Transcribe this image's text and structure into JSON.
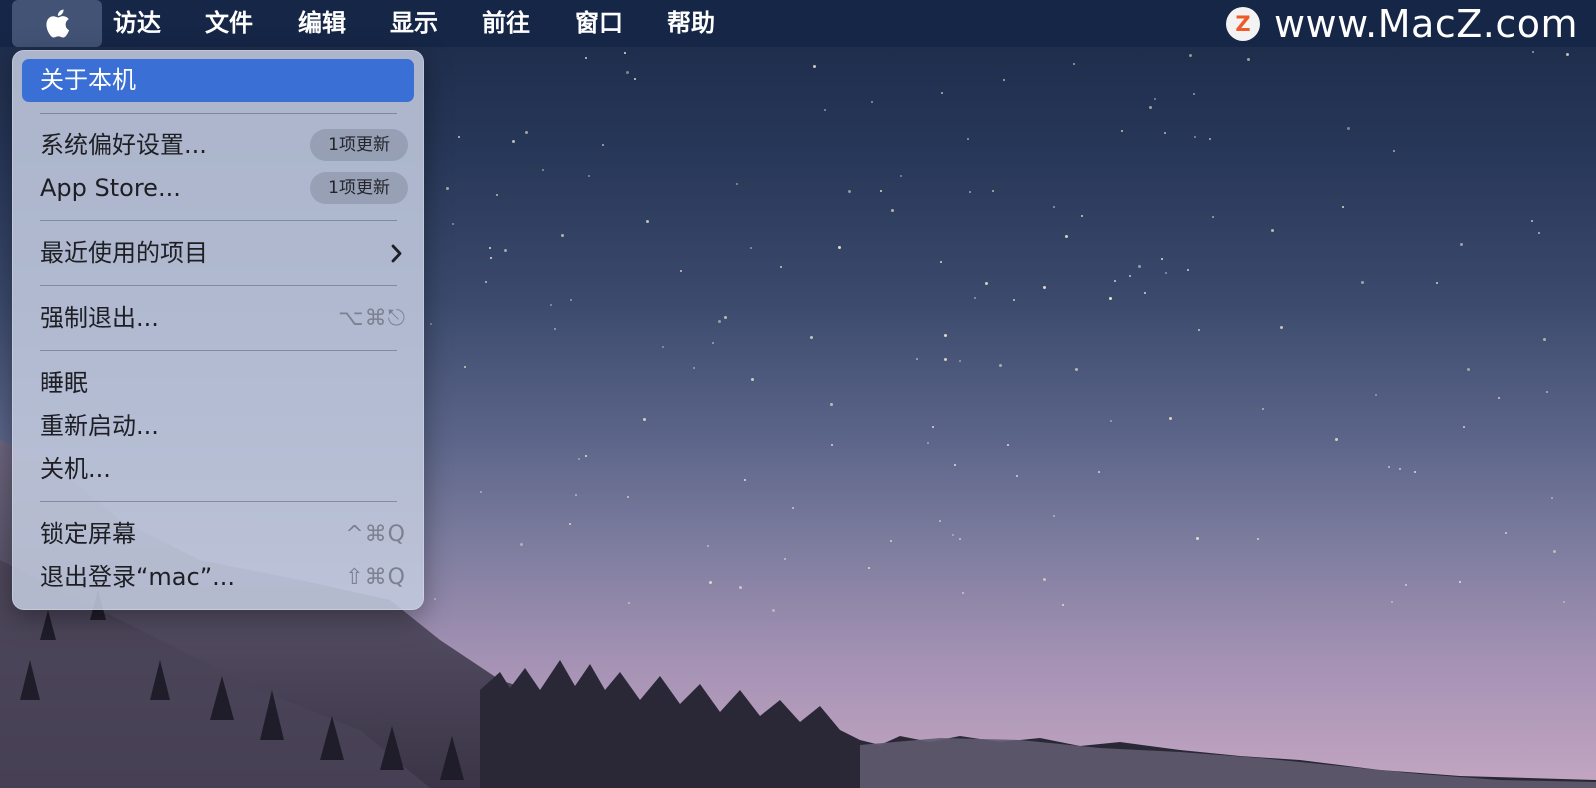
{
  "menubar": {
    "apple_icon": "apple-logo-icon",
    "menus": [
      "访达",
      "文件",
      "编辑",
      "显示",
      "前往",
      "窗口",
      "帮助"
    ]
  },
  "brand": {
    "badge_letter": "Z",
    "text": "www.MacZ.com"
  },
  "apple_menu": {
    "items": [
      {
        "label": "关于本机",
        "highlighted": true
      },
      {
        "label": "系统偏好设置...",
        "badge": "1项更新"
      },
      {
        "label": "App Store...",
        "badge": "1项更新"
      },
      {
        "label": "最近使用的项目",
        "submenu_icon": "chevron-right-icon"
      },
      {
        "label": "强制退出...",
        "shortcut": "⌥⌘⎋"
      },
      {
        "label": "睡眠"
      },
      {
        "label": "重新启动..."
      },
      {
        "label": "关机..."
      },
      {
        "label": "锁定屏幕",
        "shortcut": "^⌘Q"
      },
      {
        "label": "退出登录“mac”...",
        "shortcut": "⇧⌘Q"
      }
    ]
  },
  "colors": {
    "menubar_bg": "#162646",
    "highlight": "#3a70d6",
    "brand_accent": "#ee5a2a"
  }
}
